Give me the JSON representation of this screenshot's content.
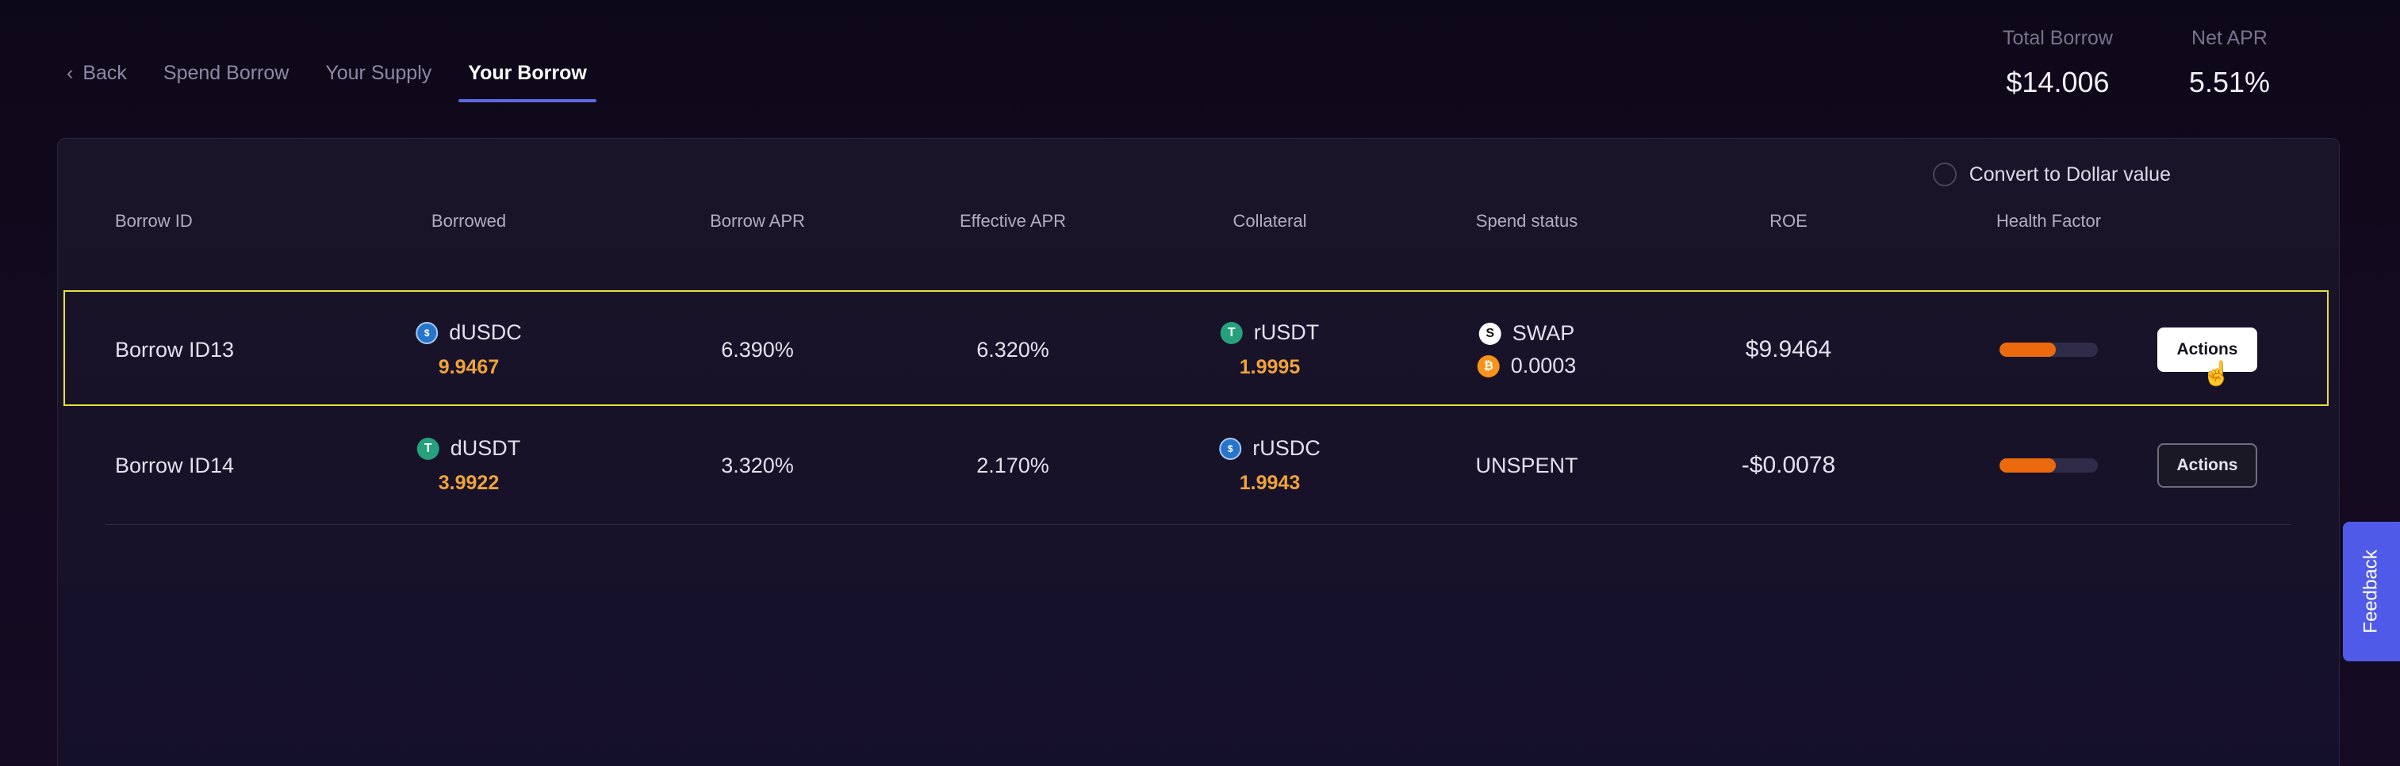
{
  "nav": {
    "back": "Back",
    "tabs": [
      "Spend Borrow",
      "Your Supply",
      "Your Borrow"
    ],
    "active_tab": "Your Borrow"
  },
  "stats": {
    "total_borrow_label": "Total Borrow",
    "total_borrow_value": "$14.006",
    "net_apr_label": "Net APR",
    "net_apr_value": "5.51%"
  },
  "convert_label": "Convert to Dollar value",
  "table": {
    "headers": [
      "Borrow ID",
      "Borrowed",
      "Borrow APR",
      "Effective APR",
      "Collateral",
      "Spend status",
      "ROE",
      "Health Factor"
    ],
    "rows": [
      {
        "id": "Borrow ID13",
        "borrowed_token": "dUSDC",
        "borrowed_icon": "usdc-icon",
        "borrowed_amount": "9.9467",
        "borrow_apr": "6.390%",
        "effective_apr": "6.320%",
        "collateral_token": "rUSDT",
        "collateral_icon": "usdt-icon",
        "collateral_amount": "1.9995",
        "spend_status": "SWAP",
        "spend_amount": "0.0003",
        "roe": "$9.9464",
        "health_factor_fill": 0.57,
        "action": "Actions"
      },
      {
        "id": "Borrow ID14",
        "borrowed_token": "dUSDT",
        "borrowed_icon": "usdt-icon",
        "borrowed_amount": "3.9922",
        "borrow_apr": "3.320%",
        "effective_apr": "2.170%",
        "collateral_token": "rUSDC",
        "collateral_icon": "usdc-icon",
        "collateral_amount": "1.9943",
        "spend_status": "UNSPENT",
        "roe": "-$0.0078",
        "health_factor_fill": 0.57,
        "action": "Actions"
      }
    ]
  },
  "feedback_label": "Feedback",
  "colors": {
    "accent": "#5b6ae0",
    "amount": "#f0a33a",
    "health_fill": "#ec6a0e",
    "highlight": "#e6e23b"
  }
}
